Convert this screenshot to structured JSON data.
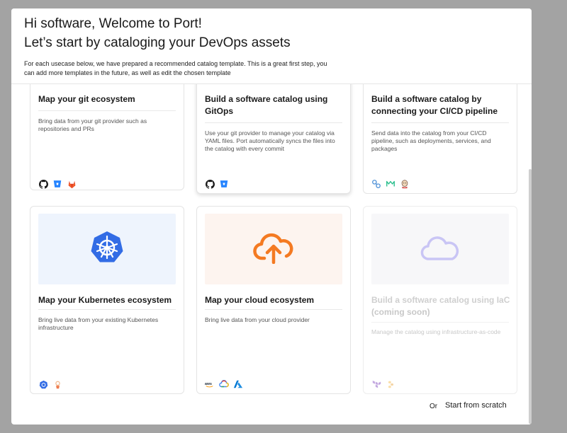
{
  "header": {
    "greeting": "Hi software, Welcome to Port!",
    "subtitle": "Let’s start by cataloging your DevOps assets",
    "description": "For each usecase below, we have prepared a recommended catalog template. This is a great first step, you can add more templates in the future, as well as edit the chosen template"
  },
  "cards": [
    {
      "title": "Map your git ecosystem",
      "description": "Bring data from your git provider such as repositories and PRs",
      "icons": [
        "github-icon",
        "bitbucket-icon",
        "gitlab-icon"
      ]
    },
    {
      "title": "Build a software catalog using GitOps",
      "description": "Use your git provider to manage your catalog via YAML files. Port automatically syncs the files into the catalog with every commit",
      "icons": [
        "github-icon",
        "bitbucket-icon"
      ]
    },
    {
      "title": "Build a software catalog by connecting your CI/CD pipeline",
      "description": "Send data into the catalog from your CI/CD pipeline, such as deployments, services, and packages",
      "icons": [
        "codefresh-icon",
        "circleci-icon",
        "jenkins-icon"
      ]
    },
    {
      "title": "Map your Kubernetes ecosystem",
      "description": "Bring live data from your existing Kubernetes infrastructure",
      "icons": [
        "kubernetes-icon",
        "argocd-icon"
      ],
      "banner_icon": "kubernetes-icon"
    },
    {
      "title": "Map your cloud ecosystem",
      "description": "Bring live data from your cloud provider",
      "icons": [
        "aws-icon",
        "gcp-icon",
        "azure-icon"
      ],
      "banner_icon": "cloud-upload-icon"
    },
    {
      "title": "Build a software catalog using IaC",
      "subtitle": "(coming soon)",
      "description": "Manage the catalog using infrastructure-as-code",
      "icons": [
        "terraform-icon",
        "pulumi-icon"
      ],
      "banner_icon": "cloud-icon"
    }
  ],
  "footer": {
    "or_text": "Or",
    "start_from_scratch": "Start from scratch"
  },
  "colors": {
    "kubernetes_blue": "#326ce5",
    "cloud_orange": "#f47a22",
    "cloud_lavender": "#c9c5f5",
    "k8s_banner_bg": "#eef4fd",
    "cloud_banner_bg": "#fdf4ef",
    "iac_banner_bg": "#f7f7f9"
  }
}
